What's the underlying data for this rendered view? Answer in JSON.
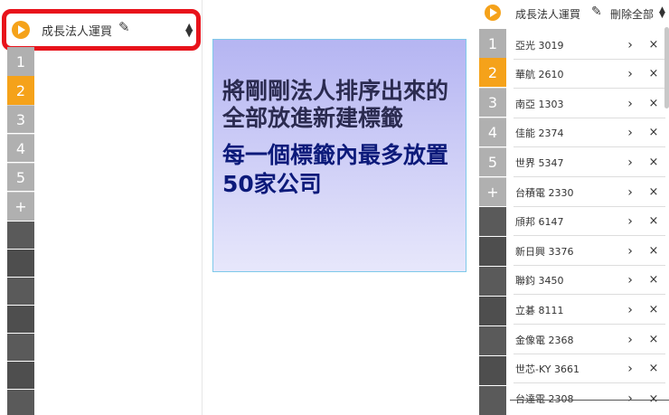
{
  "left": {
    "header": {
      "title": "成長法人運買",
      "play_icon": "play-icon",
      "edit_icon": "pencil-icon",
      "sort_icon": "updown-icon"
    },
    "tabs": [
      "1",
      "2",
      "3",
      "4",
      "5",
      "+"
    ],
    "active_tab": "2"
  },
  "center": {
    "line1": "將剛剛法人排序出來的全部放進新建標籤",
    "line2_prefix": "每一個標籤內最多放置",
    "line2_number": "50",
    "line2_suffix": "家公司"
  },
  "right": {
    "header": {
      "title": "成長法人運買",
      "delete_all": "刪除全部"
    },
    "tabs": [
      "1",
      "2",
      "3",
      "4",
      "5",
      "+"
    ],
    "active_tab": "2",
    "stocks": [
      "亞光 3019",
      "華航 2610",
      "南亞 1303",
      "佳能 2374",
      "世界 5347",
      "台積電 2330",
      "頎邦 6147",
      "新日興 3376",
      "聯鈞 3450",
      "立碁 8111",
      "金像電 2368",
      "世芯-KY 3661",
      "台達電 2308"
    ],
    "row_arrow": "›",
    "row_close": "×"
  },
  "colors": {
    "accent": "#f5a21a",
    "highlight": "#e8131b",
    "tab_grey": "#b0b0b0",
    "tab_dark": "#5a5a5a"
  }
}
